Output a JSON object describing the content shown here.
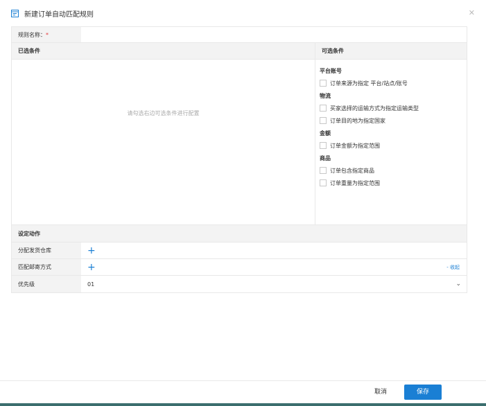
{
  "header": {
    "title": "新建订单自动匹配规则",
    "icon": "form-icon",
    "close_icon": "close-icon"
  },
  "rule_name": {
    "label": "规则名称：",
    "required_mark": "*",
    "value": ""
  },
  "conditions": {
    "selected_header": "已选条件",
    "available_header": "可选条件",
    "empty_hint": "请勾选右边可选条件进行配置",
    "groups": [
      {
        "name": "平台账号",
        "options": [
          "订单来源为指定 平台/站点/账号"
        ]
      },
      {
        "name": "物流",
        "options": [
          "买家选择的运输方式为指定运输类型",
          "订单目的地为指定国家"
        ]
      },
      {
        "name": "金额",
        "options": [
          "订单金额为指定范围"
        ]
      },
      {
        "name": "商品",
        "options": [
          "订单包含指定商品",
          "订单重量为指定范围"
        ]
      }
    ]
  },
  "actions": {
    "title": "设定动作",
    "warehouse_label": "分配发货仓库",
    "shipping_label": "匹配邮寄方式",
    "collapse_label": "- 收起",
    "priority_label": "优先级",
    "priority_value": "01"
  },
  "footer": {
    "cancel_label": "取消",
    "save_label": "保存"
  },
  "colors": {
    "accent": "#1a7fd4",
    "required": "#e4393c"
  }
}
